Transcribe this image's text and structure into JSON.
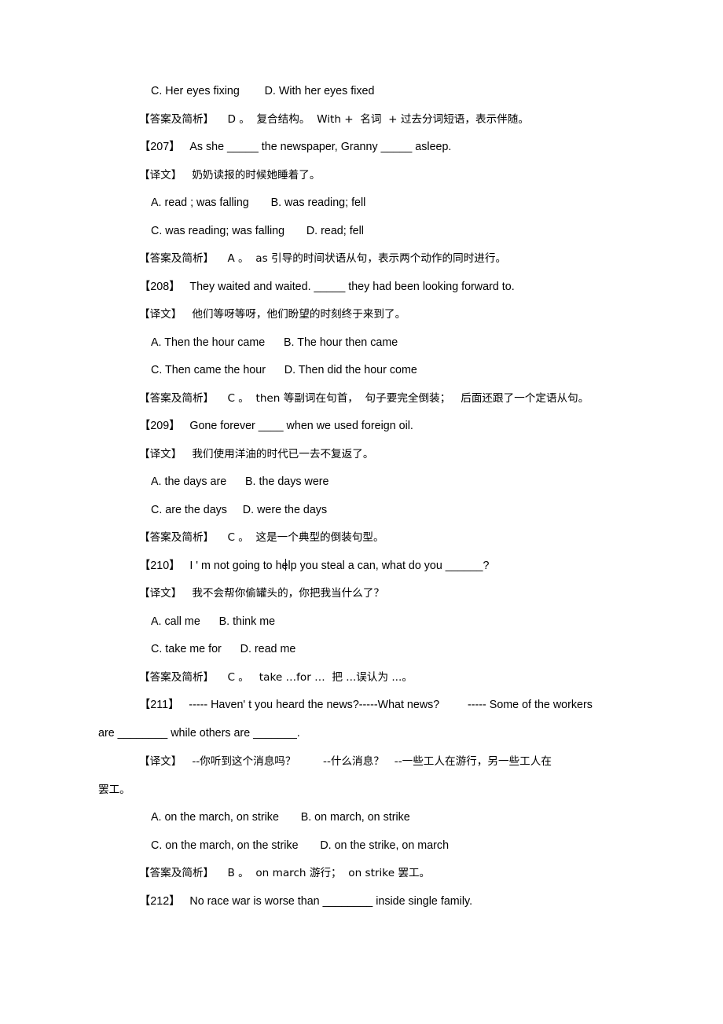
{
  "document": {
    "type": "english-grammar-exercise-page",
    "background_color": "#ffffff",
    "text_color": "#000000",
    "labels": {
      "answer_tag": "【答案及简析】",
      "translation_tag": "【译文】"
    }
  },
  "blocks": {
    "b1_options_cd": "C. Her eyes fixing        D. With her eyes fixed",
    "b2_answer_206": "【答案及简析】    D 。  复合结构。  With +  名词  + 过去分词短语，表示伴随。",
    "q207_stem": "【207】   As she _____ the newspaper, Granny _____ asleep.",
    "q207_translation": "【译文】   奶奶读报的时候她睡着了。",
    "q207_opt_ab": "A. read ; was falling       B. was reading; fell",
    "q207_opt_cd": "C. was reading; was falling       D. read; fell",
    "q207_answer": "【答案及简析】    A 。  as 引导的时间状语从句，表示两个动作的同时进行。",
    "q208_stem": "【208】   They waited and waited. _____ they had been looking forward to.",
    "q208_translation": "【译文】   他们等呀等呀，他们盼望的时刻终于来到了。",
    "q208_opt_ab": "A. Then the hour came      B. The hour then came",
    "q208_opt_cd": "C. Then came the hour      D. Then did the hour come",
    "q208_answer": "【答案及简析】    C 。  then 等副词在句首，  句子要完全倒装；   后面还跟了一个定语从句。",
    "q209_stem": "【209】   Gone forever ____ when we used foreign oil.",
    "q209_translation": "【译文】   我们使用洋油的时代已一去不复返了。",
    "q209_opt_ab": "A. the days are      B. the days were",
    "q209_opt_cd": "C. are the days     D. were the days",
    "q209_answer": "【答案及简析】    C 。  这是一个典型的倒装句型。",
    "q210_stem_pre": "【210】   I ' m not going to h",
    "q210_stem_post": "lp you steal a can, what do you ______?",
    "q210_translation": "【译文】   我不会帮你偷罐头的，你把我当什么了？",
    "q210_opt_ab": "A. call me      B. think me",
    "q210_opt_cd": "C. take me for      D. read me",
    "q210_answer": "【答案及简析】    C 。   take …for …  把 ...误认为 ...。",
    "q211_stem_line1": "【211】   ----- Haven' t you heard the news?-----What news?         ----- Some of the workers",
    "q211_stem_line2": "are ________ while others are _______.",
    "q211_translation_line1": "【译文】   --你听到这个消息吗？        --什么消息？   --一些工人在游行，另一些工人在",
    "q211_translation_line2": "罢工。",
    "q211_opt_ab": "A. on the march, on strike       B. on march, on strike",
    "q211_opt_cd": "C. on the march, on the strike       D. on the strike, on march",
    "q211_answer": "【答案及简析】    B 。  on march 游行；  on strike 罢工。",
    "q212_stem": "【212】   No race war is worse than ________ inside single family."
  }
}
